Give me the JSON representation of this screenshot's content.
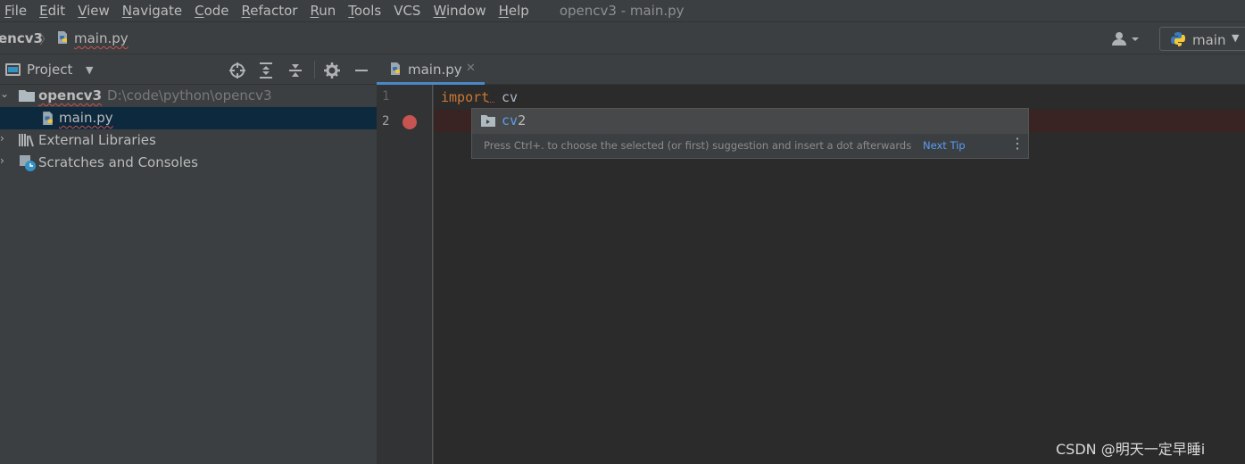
{
  "menubar": {
    "items": [
      {
        "mnemonic": "F",
        "rest": "ile"
      },
      {
        "mnemonic": "E",
        "rest": "dit"
      },
      {
        "mnemonic": "V",
        "rest": "iew"
      },
      {
        "mnemonic": "N",
        "rest": "avigate"
      },
      {
        "mnemonic": "C",
        "rest": "ode"
      },
      {
        "mnemonic": "R",
        "rest": "efactor"
      },
      {
        "mnemonic": "R",
        "rest": "un"
      },
      {
        "mnemonic": "T",
        "rest": "ools"
      },
      {
        "mnemonic": "",
        "rest": "VCS"
      },
      {
        "mnemonic": "W",
        "rest": "indow"
      },
      {
        "mnemonic": "H",
        "rest": "elp"
      }
    ],
    "window_title": "opencv3 - main.py"
  },
  "navbar": {
    "project": "encv3",
    "separator": "〉",
    "file": "main.py",
    "run_config": "main"
  },
  "project_panel": {
    "title": "Project",
    "tree": {
      "root_name": "opencv3",
      "root_path": "D:\\code\\python\\opencv3",
      "file": "main.py",
      "external": "External Libraries",
      "scratches": "Scratches and Consoles"
    }
  },
  "editor": {
    "tab_label": "main.py",
    "line_numbers": [
      "1",
      "2"
    ],
    "code_keyword": "import",
    "code_identifier": "cv"
  },
  "completion": {
    "match": "cv",
    "rest": "2",
    "hint": "Press Ctrl+. to choose the selected (or first) suggestion and insert a dot afterwards",
    "next_tip": "Next Tip"
  },
  "watermark": "CSDN @明天一定早睡i",
  "colors": {
    "keyword": "#cc7832",
    "breakpoint": "#c75450",
    "selection": "#0d293e",
    "accent": "#4a88c7"
  }
}
